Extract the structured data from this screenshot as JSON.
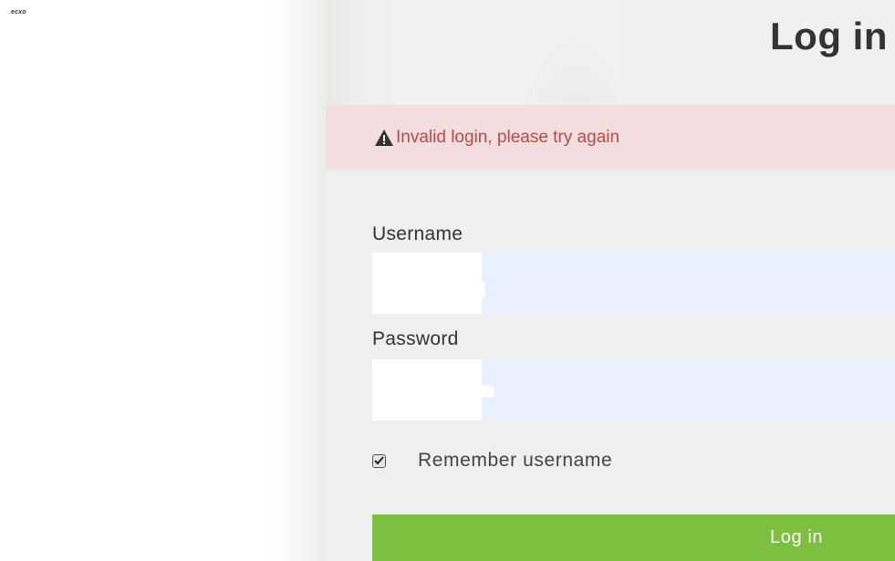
{
  "corner_mark": "ecxo",
  "page_title": "Log in",
  "alert": {
    "icon": "warning-triangle-icon",
    "message": "Invalid login, please try again",
    "background": "#f2dede",
    "text_color": "#b94a48"
  },
  "username": {
    "label": "Username",
    "value": ""
  },
  "password": {
    "label": "Password",
    "value": ""
  },
  "remember": {
    "label": "Remember username",
    "checked": true
  },
  "login_button": {
    "label": "Log in",
    "color": "#7dbf3f"
  }
}
